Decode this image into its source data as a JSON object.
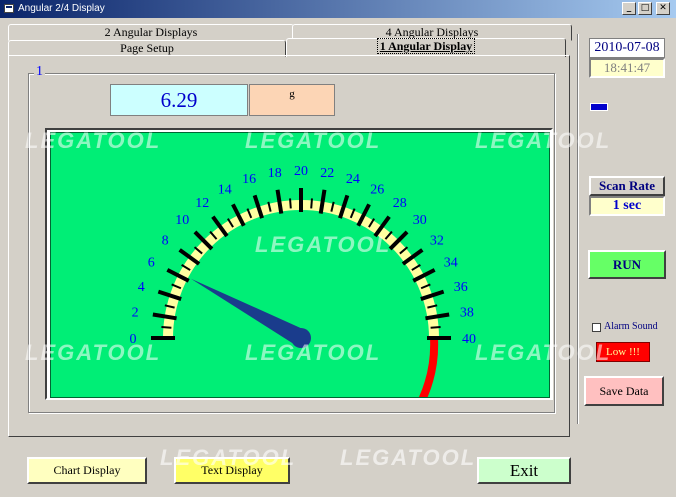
{
  "window": {
    "title": "Angular 2/4 Display"
  },
  "tabs": {
    "row_top": [
      {
        "label": "2 Angular Displays"
      },
      {
        "label": "4 Angular  Displays"
      }
    ],
    "row_bottom": [
      {
        "label": "Page Setup"
      },
      {
        "label": "1 Angular Display"
      }
    ]
  },
  "display": {
    "group_label": "1",
    "value": "6.29",
    "unit": "g"
  },
  "gauge": {
    "min": 0,
    "max": 40,
    "current": 6.29,
    "tick_labels": [
      "0",
      "2",
      "4",
      "6",
      "8",
      "10",
      "12",
      "14",
      "16",
      "18",
      "20",
      "22",
      "24",
      "26",
      "28",
      "30",
      "32",
      "34",
      "36",
      "38",
      "40"
    ],
    "colors": {
      "background": "#00ee76",
      "band": "#ffffa0",
      "needle": "#1a3c8c",
      "labels": "#0000ff",
      "alarm_arc": "#ff0000"
    }
  },
  "sidebar": {
    "date": "2010-07-08",
    "time": "18:41:47",
    "scan_rate_label": "Scan Rate",
    "scan_rate_value": "1 sec",
    "run_label": "RUN",
    "alarm_label": "Alarm Sound",
    "alarm_checked": false,
    "low_label": "Low !!!",
    "save_label": "Save Data"
  },
  "bottom": {
    "chart_label": "Chart Display",
    "text_label": "Text Display",
    "exit_label": "Exit"
  },
  "watermark": "LEGATOOL"
}
